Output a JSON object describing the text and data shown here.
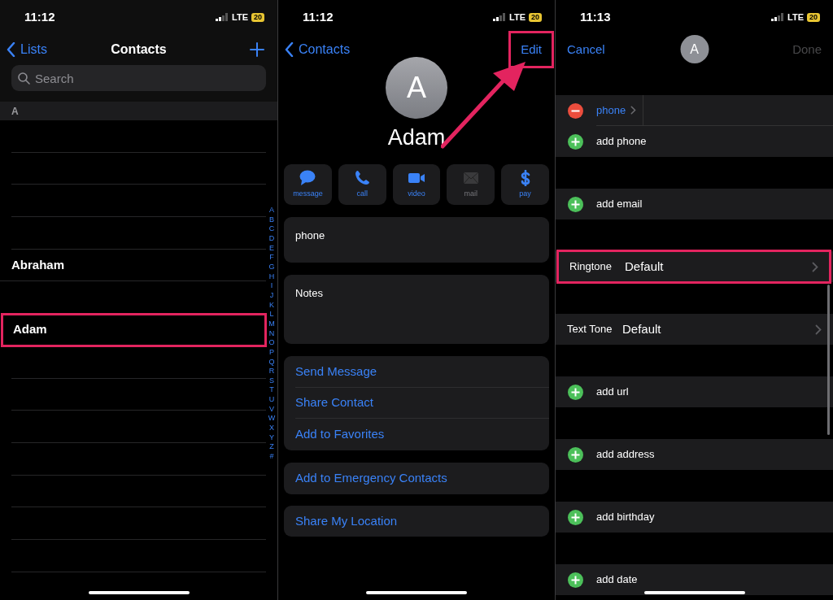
{
  "contacts_list": {
    "status": {
      "time": "11:12",
      "network": "LTE",
      "battery": "20"
    },
    "nav": {
      "back": "Lists",
      "title": "Contacts"
    },
    "search": {
      "placeholder": "Search"
    },
    "section": "A",
    "rows": [
      {
        "kind": "empty"
      },
      {
        "kind": "empty"
      },
      {
        "kind": "empty"
      },
      {
        "kind": "empty"
      },
      {
        "kind": "contact",
        "name": "Abraham",
        "highlighted": false
      },
      {
        "kind": "empty"
      },
      {
        "kind": "contact",
        "name": "Adam",
        "highlighted": true
      },
      {
        "kind": "empty"
      },
      {
        "kind": "empty"
      },
      {
        "kind": "empty"
      },
      {
        "kind": "empty"
      },
      {
        "kind": "empty"
      },
      {
        "kind": "empty"
      },
      {
        "kind": "empty"
      }
    ],
    "index": [
      "A",
      "B",
      "C",
      "D",
      "E",
      "F",
      "G",
      "H",
      "I",
      "J",
      "K",
      "L",
      "M",
      "N",
      "O",
      "P",
      "Q",
      "R",
      "S",
      "T",
      "U",
      "V",
      "W",
      "X",
      "Y",
      "Z",
      "#"
    ]
  },
  "contact_card": {
    "status": {
      "time": "11:12",
      "network": "LTE",
      "battery": "20"
    },
    "nav": {
      "back": "Contacts",
      "action": "Edit",
      "action_highlighted": true
    },
    "avatar": "A",
    "name": "Adam",
    "actions": [
      {
        "kind": "message",
        "label": "message",
        "disabled": false
      },
      {
        "kind": "call",
        "label": "call",
        "disabled": false
      },
      {
        "kind": "video",
        "label": "video",
        "disabled": false
      },
      {
        "kind": "mail",
        "label": "mail",
        "disabled": true
      },
      {
        "kind": "pay",
        "label": "pay",
        "disabled": false
      }
    ],
    "fields": [
      {
        "kind": "phone",
        "label": "phone"
      },
      {
        "kind": "notes",
        "label": "Notes"
      }
    ],
    "link_groups": [
      [
        {
          "label": "Send Message"
        },
        {
          "label": "Share Contact"
        },
        {
          "label": "Add to Favorites"
        }
      ],
      [
        {
          "label": "Add to Emergency Contacts"
        }
      ],
      [
        {
          "label": "Share My Location"
        }
      ]
    ]
  },
  "edit_contact": {
    "status": {
      "time": "11:13",
      "network": "LTE",
      "battery": "20"
    },
    "cancel": "Cancel",
    "avatar": "A",
    "done": {
      "label": "Done",
      "disabled": true
    },
    "groups": [
      [
        {
          "kind": "remove",
          "label": "phone"
        },
        {
          "kind": "add",
          "label": "add phone"
        }
      ],
      [
        {
          "kind": "add",
          "label": "add email"
        }
      ],
      [
        {
          "kind": "setting",
          "label": "Ringtone",
          "value": "Default",
          "highlighted": true
        }
      ],
      [
        {
          "kind": "setting",
          "label": "Text Tone",
          "value": "Default",
          "highlighted": false
        }
      ],
      [
        {
          "kind": "add",
          "label": "add url"
        }
      ],
      [
        {
          "kind": "add",
          "label": "add address"
        }
      ],
      [
        {
          "kind": "add",
          "label": "add birthday"
        }
      ],
      [
        {
          "kind": "add",
          "label": "add date"
        }
      ]
    ]
  }
}
